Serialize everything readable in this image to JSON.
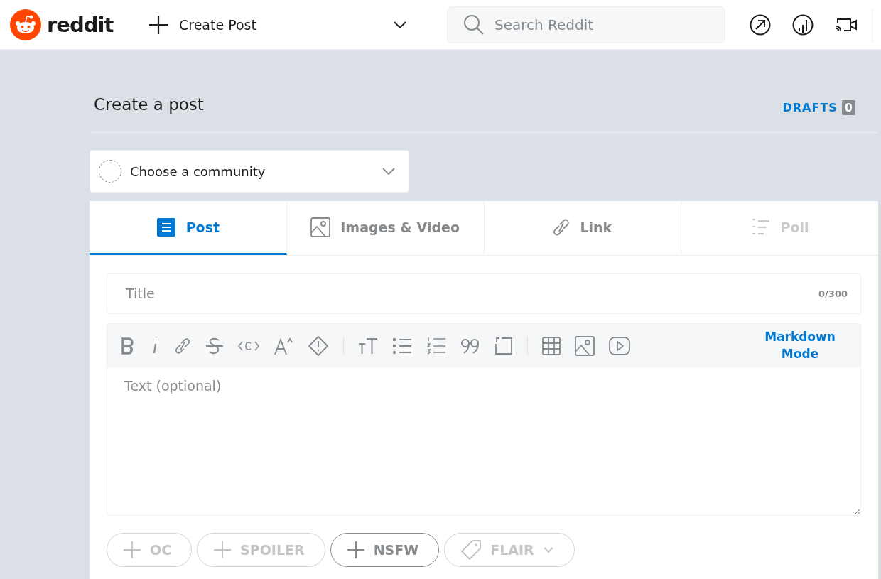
{
  "header": {
    "logo_text": "reddit",
    "create_label": "Create Post",
    "search": {
      "placeholder": "Search Reddit"
    }
  },
  "page": {
    "title": "Create a post",
    "drafts_label": "DRAFTS",
    "drafts_count": "0"
  },
  "community": {
    "placeholder": "Choose a community"
  },
  "tabs": [
    {
      "kind": "post",
      "label": "Post",
      "selected": true,
      "disabled": false
    },
    {
      "kind": "images",
      "label": "Images & Video",
      "selected": false,
      "disabled": false
    },
    {
      "kind": "link",
      "label": "Link",
      "selected": false,
      "disabled": false
    },
    {
      "kind": "poll",
      "label": "Poll",
      "selected": false,
      "disabled": true
    }
  ],
  "title_field": {
    "placeholder": "Title",
    "counter": "0/300"
  },
  "editor": {
    "mode_link": "Markdown Mode",
    "placeholder": "Text (optional)"
  },
  "tags": [
    {
      "kind": "plus",
      "label": "OC",
      "disabled": true
    },
    {
      "kind": "plus",
      "label": "SPOILER",
      "disabled": true
    },
    {
      "kind": "plus",
      "label": "NSFW",
      "disabled": false
    },
    {
      "kind": "flair",
      "label": "FLAIR",
      "disabled": true
    }
  ]
}
